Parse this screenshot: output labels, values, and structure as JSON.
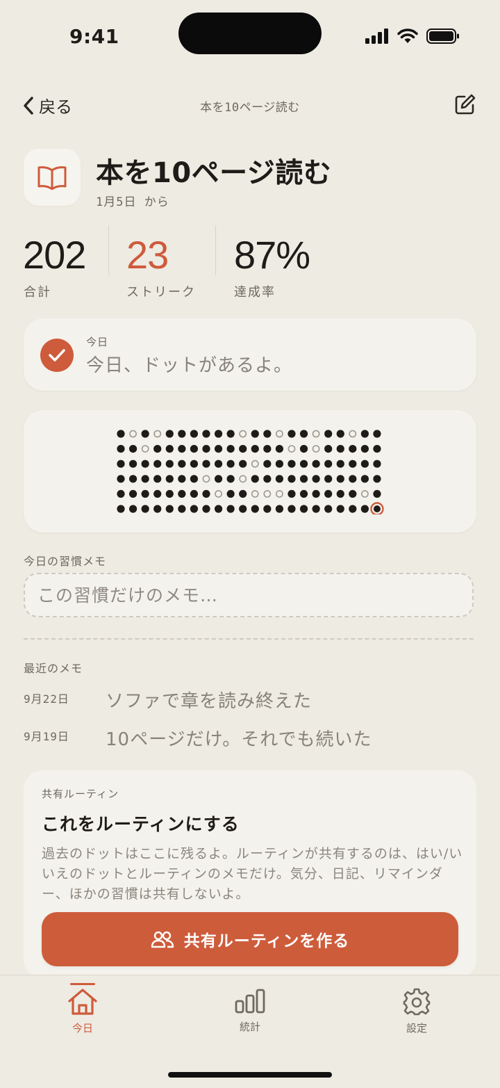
{
  "status_bar": {
    "time": "9:41"
  },
  "nav": {
    "back_label": "戻る",
    "title": "本を10ページ読む"
  },
  "habit": {
    "title": "本を10ページ読む",
    "since": "1月5日 から",
    "icon": "book-icon"
  },
  "stats": [
    {
      "value": "202",
      "label": "合計"
    },
    {
      "value": "23",
      "label": "ストリーク"
    },
    {
      "value": "87%",
      "label": "達成率"
    }
  ],
  "today": {
    "small": "今日",
    "message": "今日、ドットがあるよ。",
    "checked": true
  },
  "dots": {
    "rows": [
      "1010111111011011011011",
      "1101111111111101011111",
      "1111111111101111111111",
      "1111111011011111111111",
      "1111111101100011111101",
      "111111111111111111111T"
    ],
    "legend": {
      "1": "done",
      "0": "missed",
      "T": "today"
    }
  },
  "memo": {
    "label": "今日の習慣メモ",
    "placeholder": "この習慣だけのメモ…"
  },
  "recent": {
    "label": "最近のメモ",
    "items": [
      {
        "date": "9月22日",
        "text": "ソファで章を読み終えた"
      },
      {
        "date": "9月19日",
        "text": "10ページだけ。それでも続いた"
      }
    ]
  },
  "routine": {
    "small": "共有ルーティン",
    "title": "これをルーティンにする",
    "description": "過去のドットはここに残るよ。ルーティンが共有するのは、はい/いいえのドットとルーティンのメモだけ。気分、日記、リマインダー、ほかの習慣は共有しないよ。",
    "button_label": "共有ルーティンを作る"
  },
  "tabs": [
    {
      "label": "今日",
      "icon": "home-icon",
      "active": true
    },
    {
      "label": "統計",
      "icon": "stats-icon",
      "active": false
    },
    {
      "label": "設定",
      "icon": "gear-icon",
      "active": false
    }
  ],
  "colors": {
    "accent": "#CE5B3C",
    "background": "#EEEBE3",
    "card": "#F4F2EC",
    "ink": "#1E1B18"
  }
}
